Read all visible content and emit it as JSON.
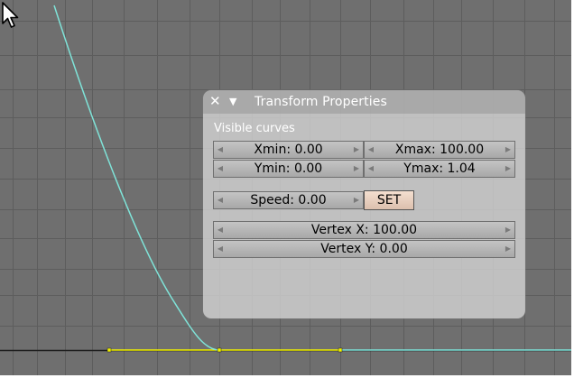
{
  "panel": {
    "title": "Transform Properties",
    "close_glyph": "✕",
    "collapse_glyph": "▼",
    "visible_curves_label": "Visible curves",
    "xmin": "Xmin: 0.00",
    "xmax": "Xmax: 100.00",
    "ymin": "Ymin: 0.00",
    "ymax": "Ymax: 1.04",
    "speed": "Speed: 0.00",
    "set_label": "SET",
    "vertex_x": "Vertex X: 100.00",
    "vertex_y": "Vertex Y: 0.00",
    "arrow_left": "◀",
    "arrow_right": "▶"
  },
  "icons": [
    "close-icon",
    "collapse-triangle-icon",
    "arrow-pointer-icon",
    "decrement-arrow-icon",
    "increment-arrow-icon"
  ],
  "colors": {
    "background": "#6f6f6f",
    "grid_line": "#5d5d5d",
    "curve_cyan": "#7fe3d8",
    "selected_curve": "#f2f200",
    "panel_bg": "#d4d4d4",
    "field_bg": "#b4b4b4",
    "set_button_bg": "#e8d0be"
  }
}
